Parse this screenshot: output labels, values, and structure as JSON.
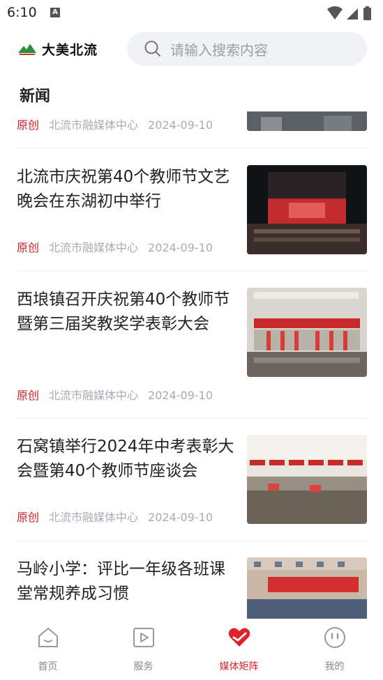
{
  "status_bar": {
    "time": "6:10",
    "notification_letter": "A"
  },
  "header": {
    "logo_text": "大美北流",
    "search_placeholder": "请输入搜索内容"
  },
  "section": {
    "title": "新闻"
  },
  "news": [
    {
      "title": "",
      "tag": "原创",
      "source": "北流市融媒体中心",
      "date": "2024-09-10"
    },
    {
      "title": "北流市庆祝第40个教师节文艺晚会在东湖初中举行",
      "tag": "原创",
      "source": "北流市融媒体中心",
      "date": "2024-09-10"
    },
    {
      "title": "西埌镇召开庆祝第40个教师节暨第三届奖教奖学表彰大会",
      "tag": "原创",
      "source": "北流市融媒体中心",
      "date": "2024-09-10"
    },
    {
      "title": "石窝镇举行2024年中考表彰大会暨第40个教师节座谈会",
      "tag": "原创",
      "source": "北流市融媒体中心",
      "date": "2024-09-10"
    },
    {
      "title": "马岭小学：评比一年级各班课堂常规养成习惯",
      "tag": "",
      "source": "",
      "date": ""
    }
  ],
  "tabbar": {
    "tabs": [
      {
        "label": "首页",
        "icon": "home-icon",
        "active": false
      },
      {
        "label": "服务",
        "icon": "play-square-icon",
        "active": false
      },
      {
        "label": "媒体矩阵",
        "icon": "heart-check-icon",
        "active": true
      },
      {
        "label": "我的",
        "icon": "smiley-icon",
        "active": false
      }
    ]
  },
  "colors": {
    "accent": "#e0222b",
    "tag_red": "#d0202a",
    "meta_gray": "#a7abb3",
    "search_bg": "#f1f2f5"
  }
}
